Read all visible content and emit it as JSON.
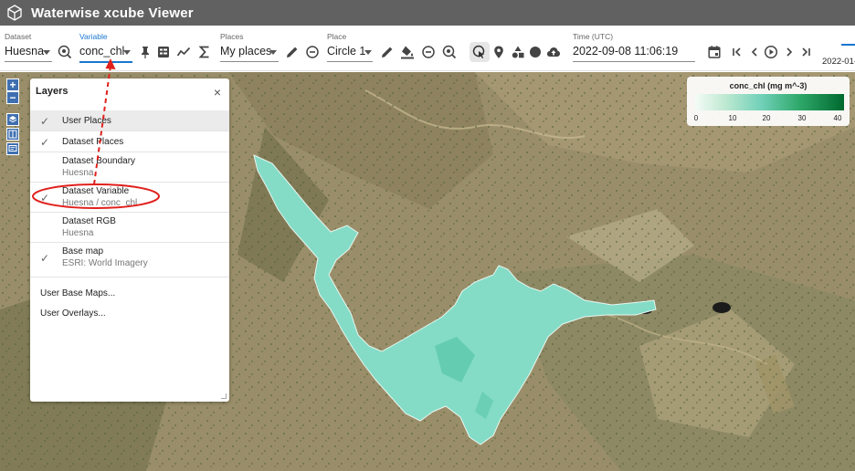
{
  "app": {
    "title": "Waterwise xcube Viewer"
  },
  "toolbar": {
    "dataset": {
      "label": "Dataset",
      "value": "Huesna"
    },
    "variable": {
      "label": "Variable",
      "value": "conc_chl"
    },
    "places": {
      "label": "Places",
      "value": "My places"
    },
    "place": {
      "label": "Place",
      "value": "Circle 1"
    },
    "time": {
      "label": "Time (UTC)",
      "value": "2022-09-08 11:06:19"
    },
    "cut_text": "2022-01-",
    "icons": [
      "dataset-info-icon",
      "variable-info-icon",
      "pin-icon",
      "compare-icon",
      "timeseries-icon",
      "statistics-icon",
      "edit-icon",
      "remove-icon",
      "edit-icon",
      "paint-icon",
      "remove-icon",
      "place-info-icon",
      "select-tool-icon",
      "point-tool-icon",
      "polygon-tool-icon",
      "circle-tool-icon",
      "upload-icon",
      "calendar-icon",
      "first-icon",
      "previous-icon",
      "play-icon",
      "next-icon",
      "last-icon"
    ]
  },
  "map": {
    "zoom_in": "+",
    "zoom_out": "−"
  },
  "layers_panel": {
    "title": "Layers",
    "close": "×",
    "items": [
      {
        "name": "User Places",
        "sub": "",
        "checked": true,
        "selected": true
      },
      {
        "name": "Dataset Places",
        "sub": "",
        "checked": true,
        "selected": false
      },
      {
        "name": "Dataset Boundary",
        "sub": "Huesna",
        "checked": false,
        "selected": false
      },
      {
        "name": "Dataset Variable",
        "sub": "Huesna / conc_chl",
        "checked": true,
        "selected": false
      },
      {
        "name": "Dataset RGB",
        "sub": "Huesna",
        "checked": false,
        "selected": false
      },
      {
        "name": "Base map",
        "sub": "ESRI: World Imagery",
        "checked": true,
        "selected": false
      }
    ],
    "links": [
      "User Base Maps...",
      "User Overlays..."
    ],
    "check_glyph": "✓"
  },
  "legend": {
    "title": "conc_chl (mg m^-3)",
    "ticks": [
      "0",
      "10",
      "20",
      "30",
      "40"
    ],
    "colors": [
      "#f4fbf6",
      "#bfe9d2",
      "#6fd0b7",
      "#2fa86a",
      "#00692e"
    ]
  },
  "annotation": {
    "color": "#e0201c"
  }
}
